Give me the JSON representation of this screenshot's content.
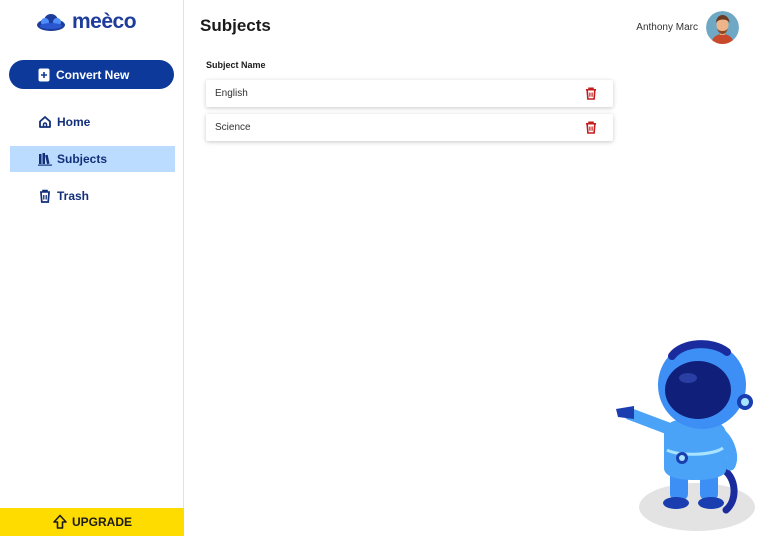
{
  "app": {
    "logo_text": "meèco"
  },
  "sidebar": {
    "convert_label": "Convert New",
    "items": [
      {
        "label": "Home",
        "icon": "home-icon",
        "active": false
      },
      {
        "label": "Subjects",
        "icon": "books-icon",
        "active": true
      },
      {
        "label": "Trash",
        "icon": "trash-icon",
        "active": false
      }
    ],
    "upgrade_label": "UPGRADE"
  },
  "header": {
    "title": "Subjects",
    "user_name": "Anthony Marc"
  },
  "table": {
    "column_header": "Subject Name",
    "rows": [
      {
        "name": "English",
        "action_icon": "trash-icon"
      },
      {
        "name": "Science",
        "action_icon": "trash-icon"
      }
    ]
  },
  "colors": {
    "brand_blue": "#0d3a9a",
    "active_nav_bg": "#bcdcff",
    "upgrade_yellow": "#ffdc00",
    "delete_red": "#c41b1b"
  }
}
